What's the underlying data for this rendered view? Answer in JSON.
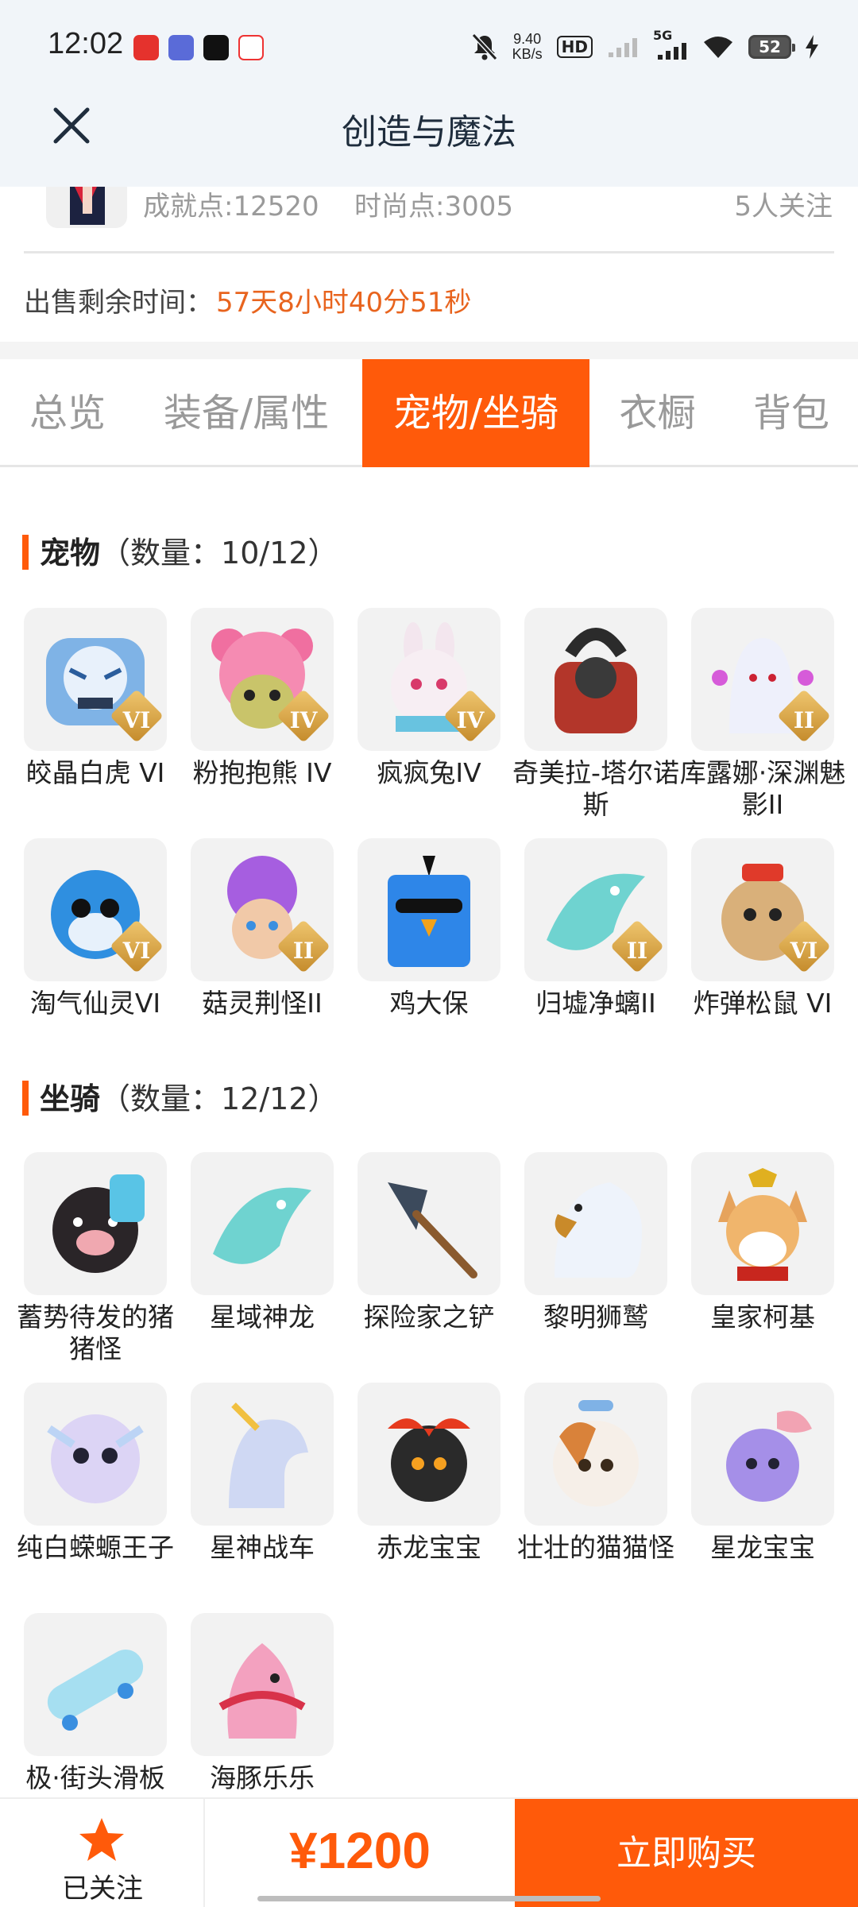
{
  "status": {
    "time": "12:02",
    "speed_value": "9.40",
    "speed_unit": "KB/s",
    "hd": "HD",
    "network": "5G",
    "battery": "52"
  },
  "header": {
    "title": "创造与魔法"
  },
  "seller": {
    "achievement": "成就点:12520",
    "fashion": "时尚点:3005",
    "followers": "5人关注"
  },
  "sale": {
    "label": "出售剩余时间：",
    "remaining": "57天8小时40分51秒"
  },
  "tabs": [
    "总览",
    "装备/属性",
    "宠物/坐骑",
    "衣橱",
    "背包"
  ],
  "active_tab": "宠物/坐骑",
  "pets": {
    "title": "宠物",
    "count": "（数量：10/12）",
    "items": [
      {
        "name": "皎晶白虎 VI",
        "tier": "VI",
        "icon": "tiger-icon"
      },
      {
        "name": "粉抱抱熊 IV",
        "tier": "IV",
        "icon": "bear-icon"
      },
      {
        "name": "疯疯兔IV",
        "tier": "IV",
        "icon": "rabbit-icon"
      },
      {
        "name": "奇美拉-塔尔诺斯",
        "tier": "",
        "icon": "chimera-icon"
      },
      {
        "name": "库露娜·深渊魅影II",
        "tier": "II",
        "icon": "ghost-icon"
      },
      {
        "name": "淘气仙灵VI",
        "tier": "VI",
        "icon": "blue-dog-icon"
      },
      {
        "name": "菇灵荆怪II",
        "tier": "II",
        "icon": "mushroom-icon"
      },
      {
        "name": "鸡大保",
        "tier": "",
        "icon": "bird-icon"
      },
      {
        "name": "归墟净螭II",
        "tier": "II",
        "icon": "dragon-icon"
      },
      {
        "name": "炸弹松鼠 VI",
        "tier": "VI",
        "icon": "squirrel-icon"
      }
    ]
  },
  "mounts": {
    "title": "坐骑",
    "count": "（数量：12/12）",
    "items": [
      {
        "name": "蓄势待发的猪猪怪",
        "icon": "pig-icon"
      },
      {
        "name": "星域神龙",
        "icon": "dragon-icon"
      },
      {
        "name": "探险家之铲",
        "icon": "shovel-icon"
      },
      {
        "name": "黎明狮鹫",
        "icon": "eagle-icon"
      },
      {
        "name": "皇家柯基",
        "icon": "corgi-icon"
      },
      {
        "name": "纯白蝾螈王子",
        "icon": "axolotl-icon"
      },
      {
        "name": "星神战车",
        "icon": "horse-icon"
      },
      {
        "name": "赤龙宝宝",
        "icon": "red-dragon-icon"
      },
      {
        "name": "壮壮的猫猫怪",
        "icon": "cat-icon"
      },
      {
        "name": "星龙宝宝",
        "icon": "baby-dragon-icon"
      },
      {
        "name": "极·街头滑板",
        "icon": "skateboard-icon"
      },
      {
        "name": "海豚乐乐",
        "icon": "dolphin-icon"
      }
    ]
  },
  "bottom": {
    "follow_label": "已关注",
    "price": "¥1200",
    "buy_label": "立即购买"
  },
  "colors": {
    "accent": "#ff5a0a",
    "countdown": "#e8641e",
    "header_bg": "#f1f5f9"
  }
}
